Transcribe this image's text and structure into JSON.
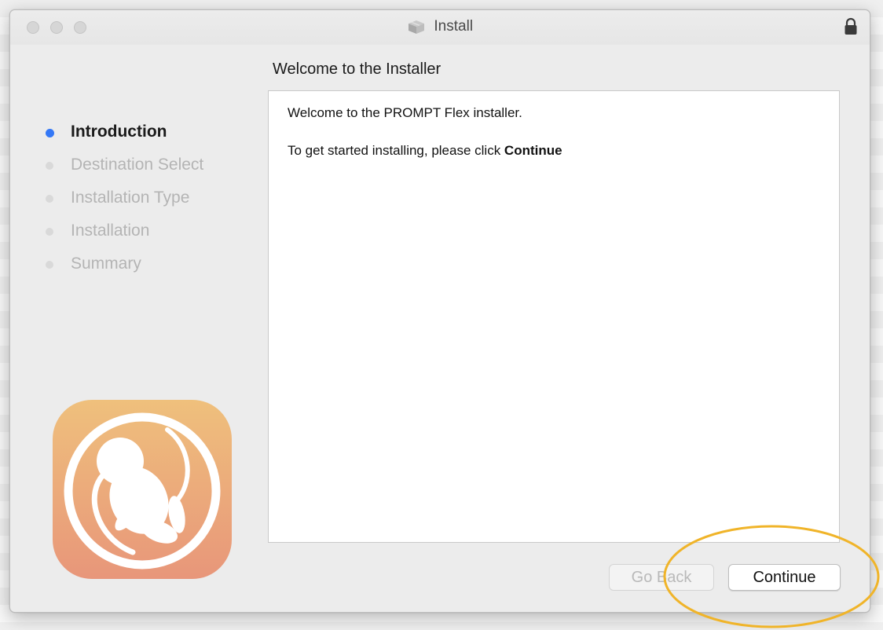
{
  "window": {
    "title": "Install",
    "title_icon": "package-box-icon",
    "lock_icon": "lock-icon"
  },
  "heading": "Welcome to the  Installer",
  "sidebar": {
    "steps": [
      {
        "label": "Introduction",
        "active": true
      },
      {
        "label": "Destination Select",
        "active": false
      },
      {
        "label": "Installation Type",
        "active": false
      },
      {
        "label": "Installation",
        "active": false
      },
      {
        "label": "Summary",
        "active": false
      }
    ],
    "app_icon": "fetus-app-icon"
  },
  "content": {
    "welcome": "Welcome to the PROMPT Flex installer.",
    "instruction_prefix": "To get started installing, please click ",
    "instruction_bold": "Continue"
  },
  "buttons": {
    "back": "Go Back",
    "continue": "Continue"
  },
  "colors": {
    "active_step": "#3478f6",
    "annotation": "#f0b429",
    "icon_gradient_top": "#efc07c",
    "icon_gradient_bottom": "#e8967a"
  }
}
